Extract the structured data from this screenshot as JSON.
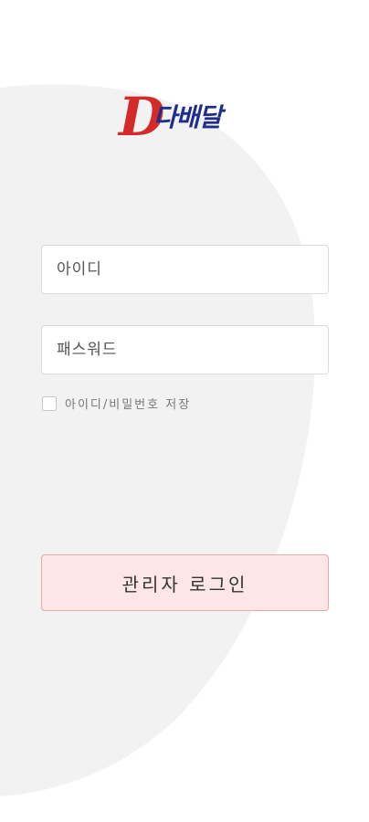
{
  "logo": {
    "letter": "D",
    "text": "다배달"
  },
  "login_form": {
    "id_placeholder": "아이디",
    "password_placeholder": "패스워드",
    "remember_label": "아이디/비밀번호 저장",
    "remember_checked": false,
    "submit_label": "관리자 로그인"
  },
  "colors": {
    "logo_red": "#d42a2a",
    "logo_blue": "#1d2f8a",
    "button_bg": "#fde6e6",
    "button_border": "#e6a9a9",
    "blob_bg": "#f2f2f2"
  }
}
